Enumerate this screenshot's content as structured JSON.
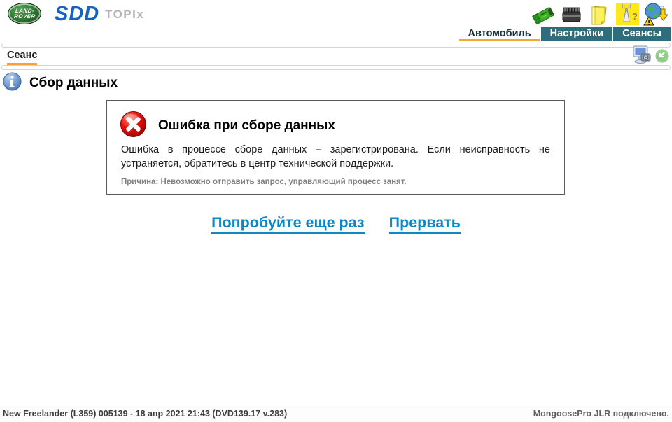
{
  "header": {
    "logo_line1": "LAND-",
    "logo_line2": "ROVER",
    "brand": "SDD",
    "portal": "TOPIx",
    "toolbar_icons": [
      "vci-device-icon",
      "battery-icon",
      "notes-icon",
      "wireless-help-icon",
      "update-download-icon"
    ],
    "wireless_question_glyph": "?"
  },
  "tabs": [
    {
      "label": "Автомобиль",
      "active": true
    },
    {
      "label": "Настройки",
      "active": false
    },
    {
      "label": "Сеансы",
      "active": false
    }
  ],
  "session_bar": {
    "tab": "Сеанс",
    "icons": [
      "screenshot-icon",
      "minimize-icon"
    ]
  },
  "main": {
    "title": "Сбор данных",
    "error": {
      "title": "Ошибка при сборе данных",
      "message": "Ошибка в процессе сборе данных – зарегистрирована. Если неисправность не устраняется, обратитесь в центр технической поддержки.",
      "cause": "Причина: Невозможно отправить запрос, управляющий процесс занят."
    },
    "links": {
      "retry": "Попробуйте еще раз",
      "cancel": "Прервать"
    }
  },
  "statusbar": {
    "vehicle_info": "New Freelander (L359) 005139 - 18 апр 2021 21:43 (DVD139.17 v.283)",
    "device_status": "MongoosePro JLR подключено."
  },
  "colors": {
    "accent_orange": "#f9a13a",
    "tab_teal": "#2e6d7c",
    "link_blue": "#1086c5",
    "brand_blue": "#1565c0",
    "logo_green": "#2e7d32",
    "error_red": "#cc0000"
  }
}
